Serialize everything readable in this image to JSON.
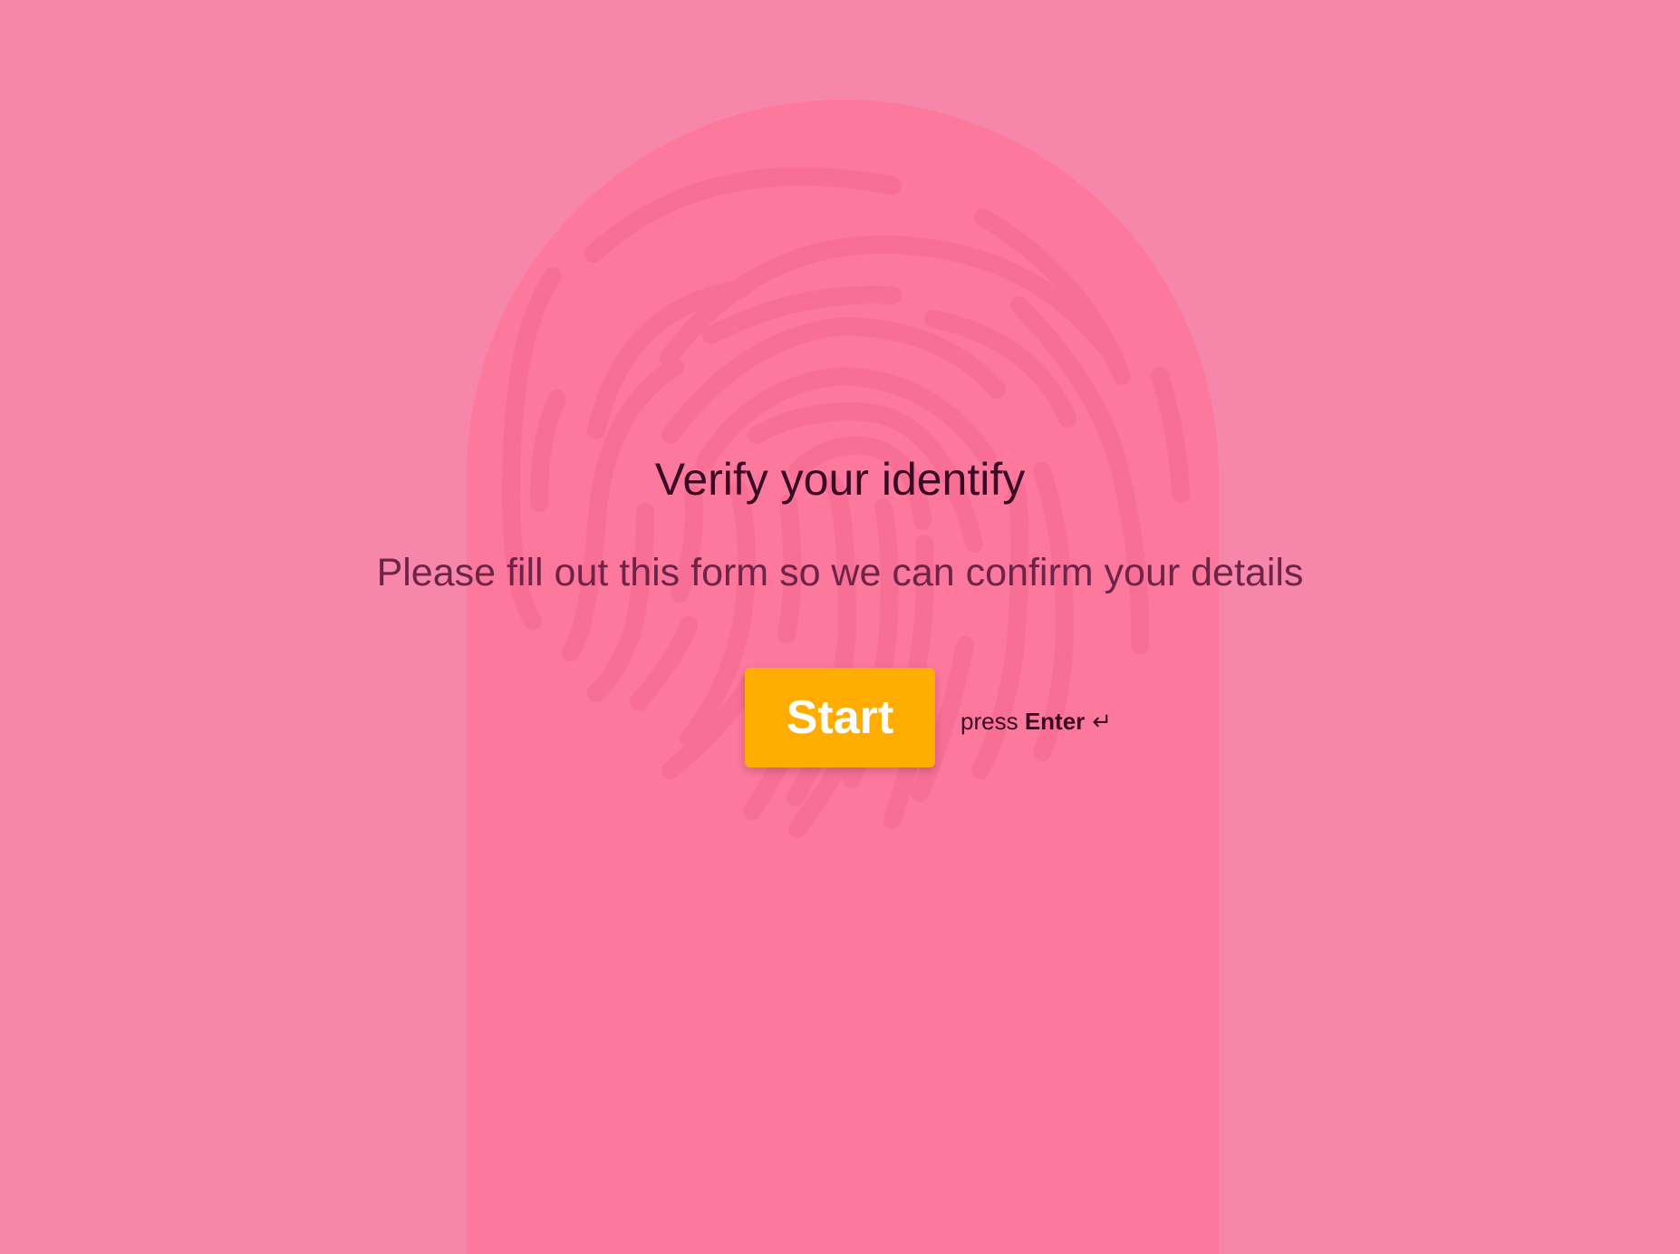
{
  "colors": {
    "background": "#f687aa",
    "arch": "#fd789d",
    "fingerprint": "#f76f95",
    "title": "#3a0a25",
    "subtitle": "#6e2449",
    "button": "#ffad00",
    "button_text": "#ffffff"
  },
  "welcome": {
    "title": "Verify your identify",
    "subtitle": "Please fill out this form so we can confirm your details",
    "start_label": "Start",
    "hint_prefix": "press ",
    "hint_key": "Enter",
    "enter_icon": "↵"
  },
  "icons": {
    "background": "fingerprint-icon",
    "enter": "enter-key-icon"
  }
}
